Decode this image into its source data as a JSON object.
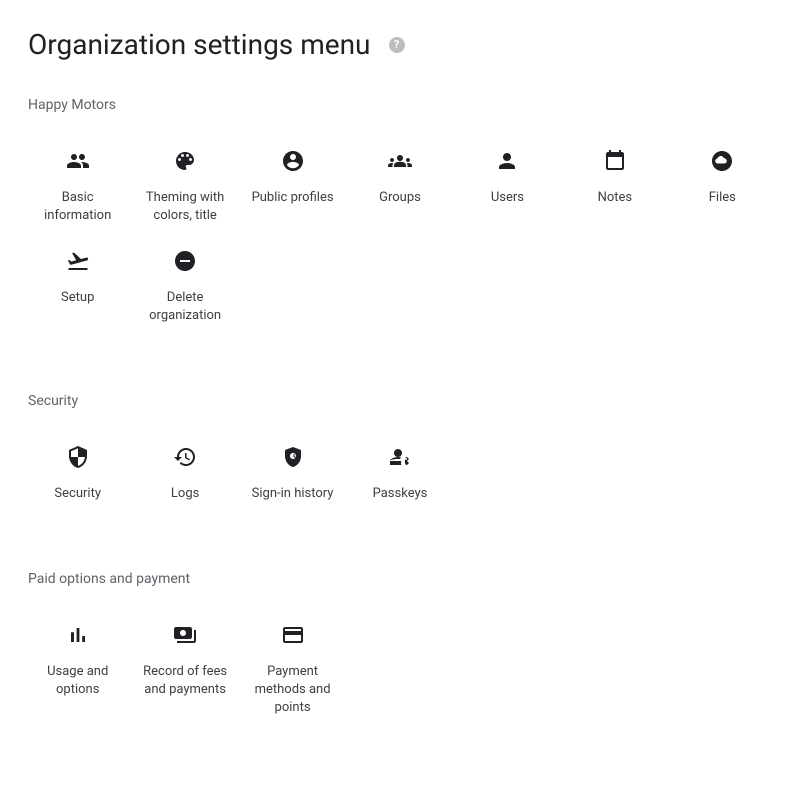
{
  "page": {
    "title": "Organization settings menu"
  },
  "sections": {
    "happy_motors": {
      "label": "Happy Motors",
      "items": {
        "basic_info": {
          "label": "Basic information"
        },
        "theming": {
          "label": "Theming with colors, title"
        },
        "public": {
          "label": "Public profiles"
        },
        "groups": {
          "label": "Groups"
        },
        "users": {
          "label": "Users"
        },
        "notes": {
          "label": "Notes"
        },
        "files": {
          "label": "Files"
        },
        "setup": {
          "label": "Setup"
        },
        "delete_org": {
          "label": "Delete organization"
        }
      }
    },
    "security": {
      "label": "Security",
      "items": {
        "security": {
          "label": "Security"
        },
        "logs": {
          "label": "Logs"
        },
        "signin": {
          "label": "Sign-in history"
        },
        "passkeys": {
          "label": "Passkeys"
        }
      }
    },
    "paid": {
      "label": "Paid options and payment",
      "items": {
        "usage": {
          "label": "Usage and options"
        },
        "record": {
          "label": "Record of fees and payments"
        },
        "payment": {
          "label": "Payment methods and points"
        }
      }
    }
  }
}
